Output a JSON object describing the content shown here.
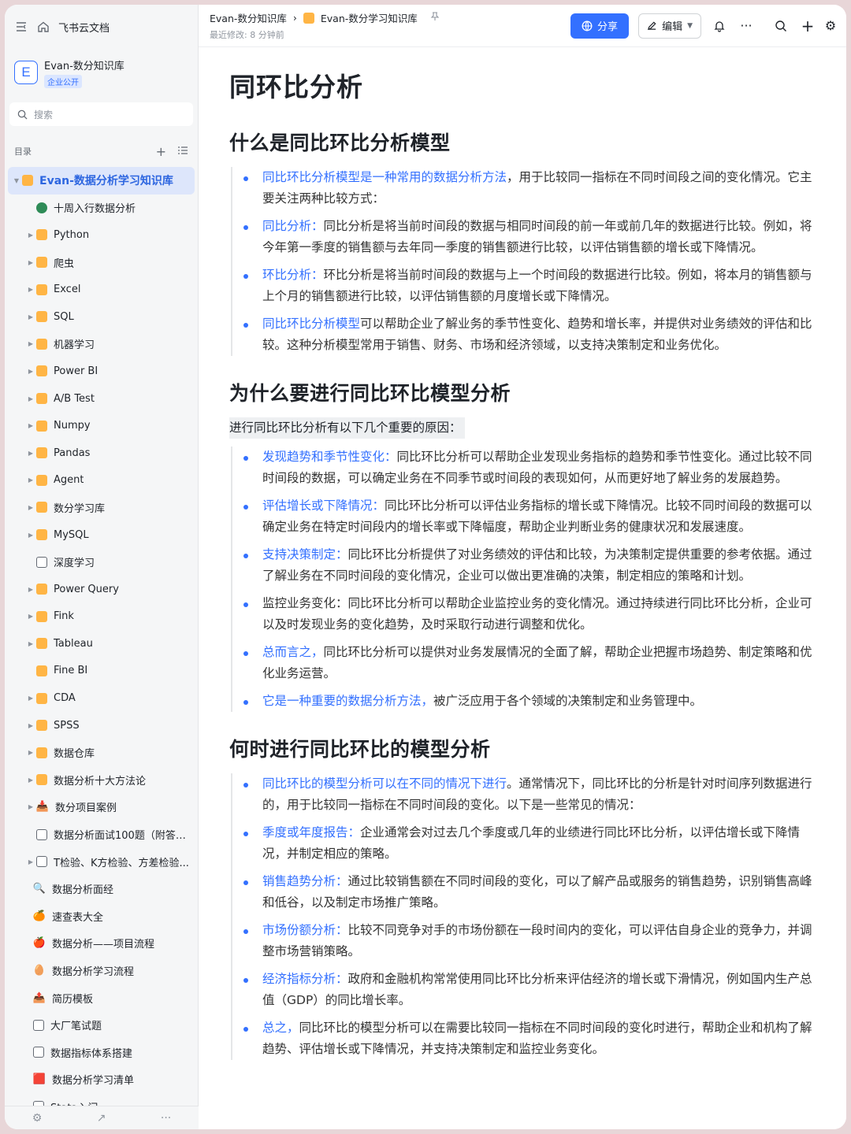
{
  "sidebar": {
    "app_name": "飞书云文档",
    "kb": {
      "logo_letter": "E",
      "name": "Evan-数分知识库",
      "badge": "企业公开"
    },
    "search_placeholder": "搜索",
    "toc_label": "目录",
    "tree": [
      {
        "label": "Evan-数据分析学习知识库",
        "icon": "folder",
        "arrow": "▼",
        "indent": 0,
        "active": true
      },
      {
        "label": "十周入行数据分析",
        "icon": "globe",
        "arrow": "",
        "indent": 1
      },
      {
        "label": "Python",
        "icon": "folder",
        "arrow": "▶",
        "indent": 1
      },
      {
        "label": "爬虫",
        "icon": "folder",
        "arrow": "▶",
        "indent": 1
      },
      {
        "label": "Excel",
        "icon": "folder",
        "arrow": "▶",
        "indent": 1
      },
      {
        "label": "SQL",
        "icon": "folder",
        "arrow": "▶",
        "indent": 1
      },
      {
        "label": "机器学习",
        "icon": "folder",
        "arrow": "▶",
        "indent": 1
      },
      {
        "label": "Power BI",
        "icon": "folder",
        "arrow": "▶",
        "indent": 1
      },
      {
        "label": "A/B Test",
        "icon": "folder",
        "arrow": "▶",
        "indent": 1
      },
      {
        "label": "Numpy",
        "icon": "folder",
        "arrow": "▶",
        "indent": 1
      },
      {
        "label": "Pandas",
        "icon": "folder",
        "arrow": "▶",
        "indent": 1
      },
      {
        "label": "Agent",
        "icon": "folder",
        "arrow": "▶",
        "indent": 1
      },
      {
        "label": "数分学习库",
        "icon": "folder",
        "arrow": "▶",
        "indent": 1
      },
      {
        "label": "MySQL",
        "icon": "folder",
        "arrow": "▶",
        "indent": 1
      },
      {
        "label": "深度学习",
        "icon": "doc",
        "arrow": "",
        "indent": 1
      },
      {
        "label": "Power Query",
        "icon": "folder",
        "arrow": "▶",
        "indent": 1
      },
      {
        "label": "Fink",
        "icon": "folder",
        "arrow": "▶",
        "indent": 1
      },
      {
        "label": "Tableau",
        "icon": "folder",
        "arrow": "▶",
        "indent": 1
      },
      {
        "label": "Fine BI",
        "icon": "folder",
        "arrow": "",
        "indent": 1
      },
      {
        "label": "CDA",
        "icon": "folder",
        "arrow": "▶",
        "indent": 1
      },
      {
        "label": "SPSS",
        "icon": "folder",
        "arrow": "▶",
        "indent": 1
      },
      {
        "label": "数据仓库",
        "icon": "folder",
        "arrow": "▶",
        "indent": 1
      },
      {
        "label": "数据分析十大方法论",
        "icon": "folder",
        "arrow": "▶",
        "indent": 1
      },
      {
        "label": "数分项目案例",
        "icon": "emoji",
        "emoji": "📥",
        "arrow": "▶",
        "indent": 1
      },
      {
        "label": "数据分析面试100题（附答案...",
        "icon": "doc",
        "arrow": "",
        "indent": 1
      },
      {
        "label": "T检验、K方检验、方差检验...",
        "icon": "doc",
        "arrow": "▶",
        "indent": 1
      },
      {
        "label": "数据分析面经",
        "icon": "emoji",
        "emoji": "🔍",
        "arrow": "",
        "indent": 0
      },
      {
        "label": "速查表大全",
        "icon": "emoji",
        "emoji": "🍊",
        "arrow": "",
        "indent": 0
      },
      {
        "label": "数据分析——项目流程",
        "icon": "emoji",
        "emoji": "🍎",
        "arrow": "",
        "indent": 0
      },
      {
        "label": "数据分析学习流程",
        "icon": "emoji",
        "emoji": "🥚",
        "arrow": "",
        "indent": 0
      },
      {
        "label": "简历模板",
        "icon": "emoji",
        "emoji": "📤",
        "arrow": "",
        "indent": 0
      },
      {
        "label": "大厂笔试题",
        "icon": "doc",
        "arrow": "",
        "indent": 0
      },
      {
        "label": "数据指标体系搭建",
        "icon": "doc",
        "arrow": "",
        "indent": 0
      },
      {
        "label": "数据分析学习清单",
        "icon": "emoji",
        "emoji": "🟥",
        "arrow": "",
        "indent": 0
      },
      {
        "label": "Stata入门",
        "icon": "doc",
        "arrow": "",
        "indent": 0
      }
    ]
  },
  "topbar": {
    "crumb_kb": "Evan-数分知识库",
    "crumb_sep": "›",
    "crumb_page": "Evan-数分学习知识库",
    "last_modified": "最近修改: 8 分钟前",
    "share_label": "分享",
    "edit_label": "编辑"
  },
  "doc": {
    "title": "同环比分析",
    "sections": [
      {
        "heading": "什么是同比环比分析模型",
        "items": [
          {
            "hl": "同比环比分析模型是一种常用的数据分析方法",
            "text": "，用于比较同一指标在不同时间段之间的变化情况。它主要关注两种比较方式："
          },
          {
            "hl": "同比分析：",
            "text": "同比分析是将当前时间段的数据与相同时间段的前一年或前几年的数据进行比较。例如，将今年第一季度的销售额与去年同一季度的销售额进行比较，以评估销售额的增长或下降情况。"
          },
          {
            "hl": "环比分析：",
            "text": "环比分析是将当前时间段的数据与上一个时间段的数据进行比较。例如，将本月的销售额与上个月的销售额进行比较，以评估销售额的月度增长或下降情况。"
          },
          {
            "hl": "同比环比分析模型",
            "text": "可以帮助企业了解业务的季节性变化、趋势和增长率，并提供对业务绩效的评估和比较。这种分析模型常用于销售、财务、市场和经济领域，以支持决策制定和业务优化。"
          }
        ]
      },
      {
        "heading": "为什么要进行同比环比模型分析",
        "intro": "进行同比环比分析有以下几个重要的原因：",
        "items": [
          {
            "hl": "发现趋势和季节性变化：",
            "text": "同比环比分析可以帮助企业发现业务指标的趋势和季节性变化。通过比较不同时间段的数据，可以确定业务在不同季节或时间段的表现如何，从而更好地了解业务的发展趋势。"
          },
          {
            "hl": "评估增长或下降情况：",
            "text": "同比环比分析可以评估业务指标的增长或下降情况。比较不同时间段的数据可以确定业务在特定时间段内的增长率或下降幅度，帮助企业判断业务的健康状况和发展速度。"
          },
          {
            "hl": "支持决策制定：",
            "text": "同比环比分析提供了对业务绩效的评估和比较，为决策制定提供重要的参考依据。通过了解业务在不同时间段的变化情况，企业可以做出更准确的决策，制定相应的策略和计划。"
          },
          {
            "hl": "",
            "text": "监控业务变化：同比环比分析可以帮助企业监控业务的变化情况。通过持续进行同比环比分析，企业可以及时发现业务的变化趋势，及时采取行动进行调整和优化。"
          },
          {
            "hl": "总而言之，",
            "text": "同比环比分析可以提供对业务发展情况的全面了解，帮助企业把握市场趋势、制定策略和优化业务运营。"
          },
          {
            "hl": "它是一种重要的数据分析方法，",
            "text": "被广泛应用于各个领域的决策制定和业务管理中。"
          }
        ]
      },
      {
        "heading": "何时进行同比环比的模型分析",
        "items": [
          {
            "hl": "同比环比的模型分析可以在不同的情况下进行",
            "text": "。通常情况下，同比环比的分析是针对时间序列数据进行的，用于比较同一指标在不同时间段的变化。以下是一些常见的情况："
          },
          {
            "hl": "季度或年度报告：",
            "text": "企业通常会对过去几个季度或几年的业绩进行同比环比分析，以评估增长或下降情况，并制定相应的策略。"
          },
          {
            "hl": "销售趋势分析：",
            "text": "通过比较销售额在不同时间段的变化，可以了解产品或服务的销售趋势，识别销售高峰和低谷，以及制定市场推广策略。"
          },
          {
            "hl": "市场份额分析：",
            "text": "比较不同竞争对手的市场份额在一段时间内的变化，可以评估自身企业的竞争力，并调整市场营销策略。"
          },
          {
            "hl": "经济指标分析：",
            "text": "政府和金融机构常常使用同比环比分析来评估经济的增长或下滑情况，例如国内生产总值（GDP）的同比增长率。"
          },
          {
            "hl": "总之，",
            "text": "同比环比的模型分析可以在需要比较同一指标在不同时间段的变化时进行，帮助企业和机构了解趋势、评估增长或下降情况，并支持决策制定和监控业务变化。"
          }
        ]
      }
    ]
  },
  "colors": {
    "accent": "#3370ff",
    "folder": "#ffb545"
  }
}
